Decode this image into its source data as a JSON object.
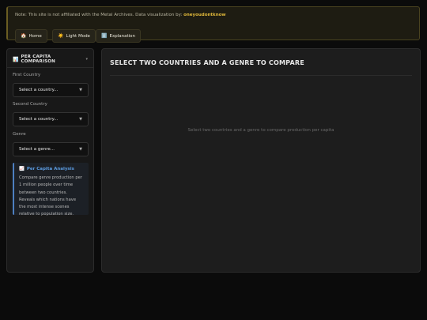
{
  "notice": {
    "text": "Note: This site is not affiliated with the Metal Archives. Data visualization by:",
    "author": "oneyoudontknow"
  },
  "nav": [
    {
      "icon": "🏠",
      "icon_name": "home-icon",
      "label": "Home"
    },
    {
      "icon": "☀️",
      "icon_name": "sun-icon",
      "label": "Light Mode"
    },
    {
      "icon": "ℹ️",
      "icon_name": "info-icon",
      "label": "Explanation"
    }
  ],
  "sidebar": {
    "icon": "📊",
    "title": "Per Capita Comparison",
    "first_label": "First Country",
    "first_value": "Select a country...",
    "second_label": "Second Country",
    "second_value": "Select a country...",
    "genre_label": "Genre",
    "genre_value": "Select a genre...",
    "info_icon": "📈",
    "info_title": "Per Capita Analysis",
    "info_body": "Compare genre production per 1 million people over time between two countries. Reveals which nations have the most intense scenes relative to population size."
  },
  "main": {
    "title": "Select two countries and a genre to compare",
    "placeholder": "Select two countries and a genre to compare production per capita"
  },
  "colors": {
    "background": "#0b0b0b",
    "notice_author": "#e0b83a",
    "info_accent": "#4d7fc0"
  }
}
